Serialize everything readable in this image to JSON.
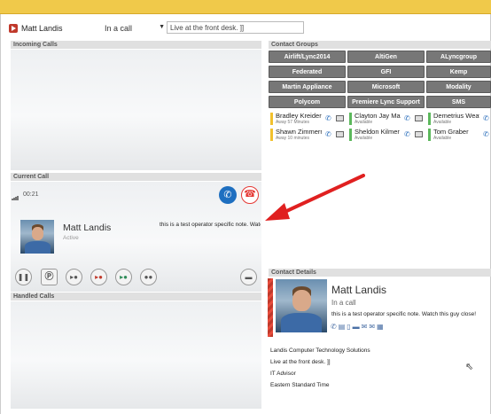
{
  "header": {
    "user_name": "Matt Landis",
    "presence": "In a call",
    "note_value": "Live at the front desk. ]]"
  },
  "panels": {
    "incoming_calls": "Incoming Calls",
    "contact_groups": "Contact Groups",
    "current_call": "Current Call",
    "handled_calls": "Handled Calls",
    "contact_details": "Contact Details"
  },
  "contact_groups": [
    "Airlift/Lync2014",
    "AltiGen",
    "ALyncgroup",
    "Federated",
    "GFI",
    "Kemp",
    "Martin Appliance",
    "Microsoft",
    "Modality",
    "Polycom",
    "Premiere Lync Support",
    "SMS"
  ],
  "contacts": [
    {
      "name": "Bradley Kreider",
      "status": "Away 57 Minutes",
      "color": "#f2c12e"
    },
    {
      "name": "Clayton Jay Martin",
      "status": "Available",
      "color": "#5cb85c"
    },
    {
      "name": "Demetrius Weaver",
      "status": "Available",
      "color": "#5cb85c"
    },
    {
      "name": "Shawn Zimmerman",
      "status": "Away 10 minutes",
      "color": "#f2c12e"
    },
    {
      "name": "Sheldon Kilmer",
      "status": "Available",
      "color": "#5cb85c"
    },
    {
      "name": "Tom Graber",
      "status": "Available",
      "color": "#5cb85c"
    }
  ],
  "current_call": {
    "timer": "00:21",
    "name": "Matt Landis",
    "status": "Active",
    "note": "this is a test operator specific note. Watch this guy close!"
  },
  "contact_details": {
    "name": "Matt Landis",
    "status": "In a call",
    "note": "this is a test operator specific note. Watch this guy close!",
    "company": "Landis Computer Technology Solutions",
    "location": "Live at the front desk. ]]",
    "title": "IT Advisor",
    "timezone": "Eastern Standard Time"
  },
  "colors": {
    "topbar": "#f0c94a",
    "group_button": "#777777",
    "hangup": "#e53935",
    "answer": "#1e6fc0",
    "arrow": "#e02020"
  }
}
